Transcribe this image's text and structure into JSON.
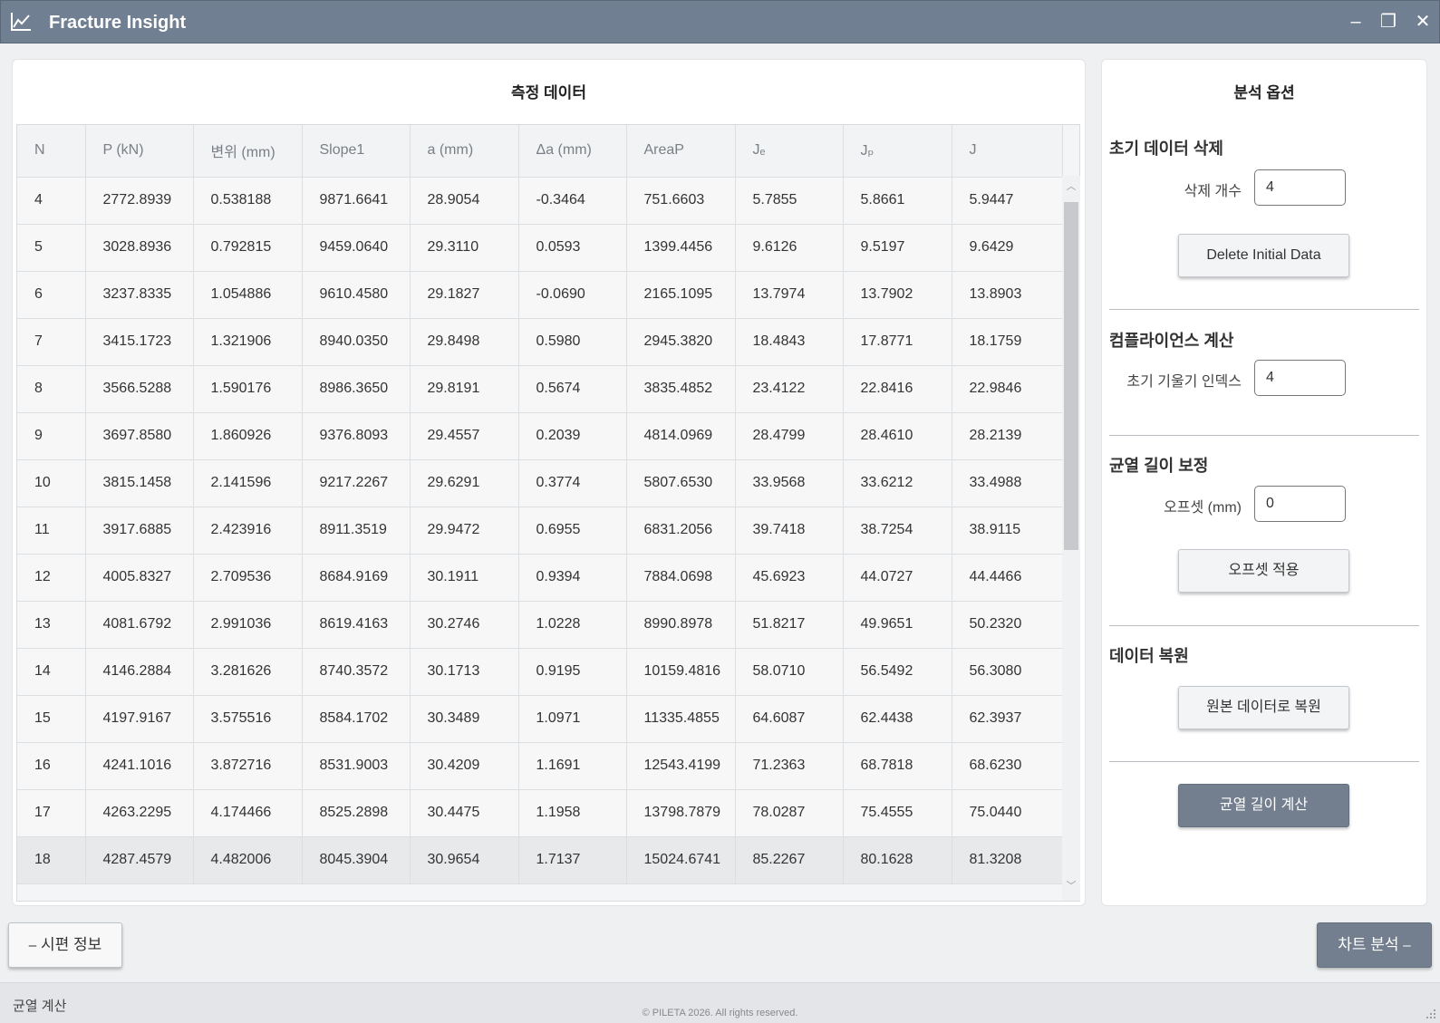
{
  "window": {
    "title": "Fracture Insight",
    "min_glyph": "–",
    "max_glyph": "❐",
    "close_glyph": "✕"
  },
  "data_panel": {
    "title": "측정 데이터"
  },
  "table": {
    "headers": [
      "N",
      "P (kN)",
      "변위 (mm)",
      "Slope1",
      "a (mm)",
      "Δa (mm)",
      "AreaP",
      "Jₑ",
      "Jₚ",
      "J"
    ],
    "rows": [
      [
        "4",
        "2772.8939",
        "0.538188",
        "9871.6641",
        "28.9054",
        "-0.3464",
        "751.6603",
        "5.7855",
        "5.8661",
        "5.9447"
      ],
      [
        "5",
        "3028.8936",
        "0.792815",
        "9459.0640",
        "29.3110",
        "0.0593",
        "1399.4456",
        "9.6126",
        "9.5197",
        "9.6429"
      ],
      [
        "6",
        "3237.8335",
        "1.054886",
        "9610.4580",
        "29.1827",
        "-0.0690",
        "2165.1095",
        "13.7974",
        "13.7902",
        "13.8903"
      ],
      [
        "7",
        "3415.1723",
        "1.321906",
        "8940.0350",
        "29.8498",
        "0.5980",
        "2945.3820",
        "18.4843",
        "17.8771",
        "18.1759"
      ],
      [
        "8",
        "3566.5288",
        "1.590176",
        "8986.3650",
        "29.8191",
        "0.5674",
        "3835.4852",
        "23.4122",
        "22.8416",
        "22.9846"
      ],
      [
        "9",
        "3697.8580",
        "1.860926",
        "9376.8093",
        "29.4557",
        "0.2039",
        "4814.0969",
        "28.4799",
        "28.4610",
        "28.2139"
      ],
      [
        "10",
        "3815.1458",
        "2.141596",
        "9217.2267",
        "29.6291",
        "0.3774",
        "5807.6530",
        "33.9568",
        "33.6212",
        "33.4988"
      ],
      [
        "11",
        "3917.6885",
        "2.423916",
        "8911.3519",
        "29.9472",
        "0.6955",
        "6831.2056",
        "39.7418",
        "38.7254",
        "38.9115"
      ],
      [
        "12",
        "4005.8327",
        "2.709536",
        "8684.9169",
        "30.1911",
        "0.9394",
        "7884.0698",
        "45.6923",
        "44.0727",
        "44.4466"
      ],
      [
        "13",
        "4081.6792",
        "2.991036",
        "8619.4163",
        "30.2746",
        "1.0228",
        "8990.8978",
        "51.8217",
        "49.9651",
        "50.2320"
      ],
      [
        "14",
        "4146.2884",
        "3.281626",
        "8740.3572",
        "30.1713",
        "0.9195",
        "10159.4816",
        "58.0710",
        "56.5492",
        "56.3080"
      ],
      [
        "15",
        "4197.9167",
        "3.575516",
        "8584.1702",
        "30.3489",
        "1.0971",
        "11335.4855",
        "64.6087",
        "62.4438",
        "62.3937"
      ],
      [
        "16",
        "4241.1016",
        "3.872716",
        "8531.9003",
        "30.4209",
        "1.1691",
        "12543.4199",
        "71.2363",
        "68.7818",
        "68.6230"
      ],
      [
        "17",
        "4263.2295",
        "4.174466",
        "8525.2898",
        "30.4475",
        "1.1958",
        "13798.7879",
        "78.0287",
        "75.4555",
        "75.0440"
      ],
      [
        "18",
        "4287.4579",
        "4.482006",
        "8045.3904",
        "30.9654",
        "1.7137",
        "15024.6741",
        "85.2267",
        "80.1628",
        "81.3208"
      ]
    ],
    "selected_row": 14
  },
  "options": {
    "title": "분석 옵션",
    "delete_section": {
      "title": "초기 데이터 삭제",
      "label": "삭제 개수",
      "value": "4",
      "button": "Delete Initial Data"
    },
    "compliance_section": {
      "title": "컴플라이언스 계산",
      "label": "초기 기울기 인덱스",
      "value": "4"
    },
    "crack_section": {
      "title": "균열 길이 보정",
      "label": "오프셋 (mm)",
      "value": "0",
      "button": "오프셋 적용"
    },
    "restore_section": {
      "title": "데이터 복원",
      "button": "원본 데이터로 복원"
    },
    "compute_button": "균열 길이 계산"
  },
  "nav": {
    "prev": "⎯ 시편 정보",
    "next": "차트 분석 ⎯"
  },
  "status": {
    "text": "균열 계산",
    "copyright": "© PILETA 2026. All rights reserved."
  },
  "colors": {
    "titlebar": "#707f92",
    "primary_button": "#737f8f"
  }
}
